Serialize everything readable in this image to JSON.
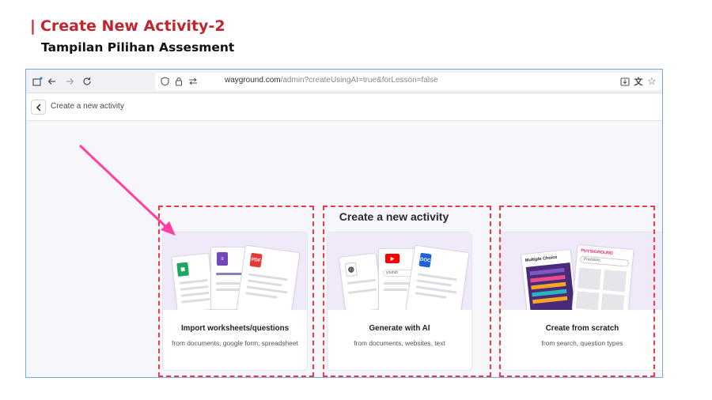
{
  "slide": {
    "title": "Create New Activity-2",
    "subtitle": "Tampilan Pilihan Assesment"
  },
  "browser": {
    "url_host": "wayground.com",
    "url_path": "/admin?createUsingAI=true&forLesson=false"
  },
  "app": {
    "header_title": "Create a new activity",
    "content_title": "Create a new activity"
  },
  "cards": [
    {
      "title": "Import worksheets/questions",
      "description": "from documents, google form, spreadsheet",
      "illustration": {
        "pdf_label": "PDF"
      }
    },
    {
      "title": "Generate with AI",
      "description": "from documents, websites, text",
      "illustration": {
        "doc_label": "DOC",
        "link_text": "youtub"
      }
    },
    {
      "title": "Create from scratch",
      "description": "from search, question types",
      "illustration": {
        "mc_label": "Multiple Choice",
        "brand_label": "PHYSIGROUND",
        "search_text": "Fractions"
      }
    }
  ],
  "colors": {
    "title_red": "#c0262d",
    "highlight_dash": "#ee3b43",
    "arrow": "#ff3fa4",
    "card_illustration_bg": "#efe9fa"
  },
  "icons": [
    "new-tab-icon",
    "back-arrow-icon",
    "forward-arrow-icon",
    "reload-icon",
    "shield-icon",
    "lock-icon",
    "permissions-icon",
    "download-icon",
    "translate-icon",
    "star-icon",
    "chevron-left-icon"
  ]
}
